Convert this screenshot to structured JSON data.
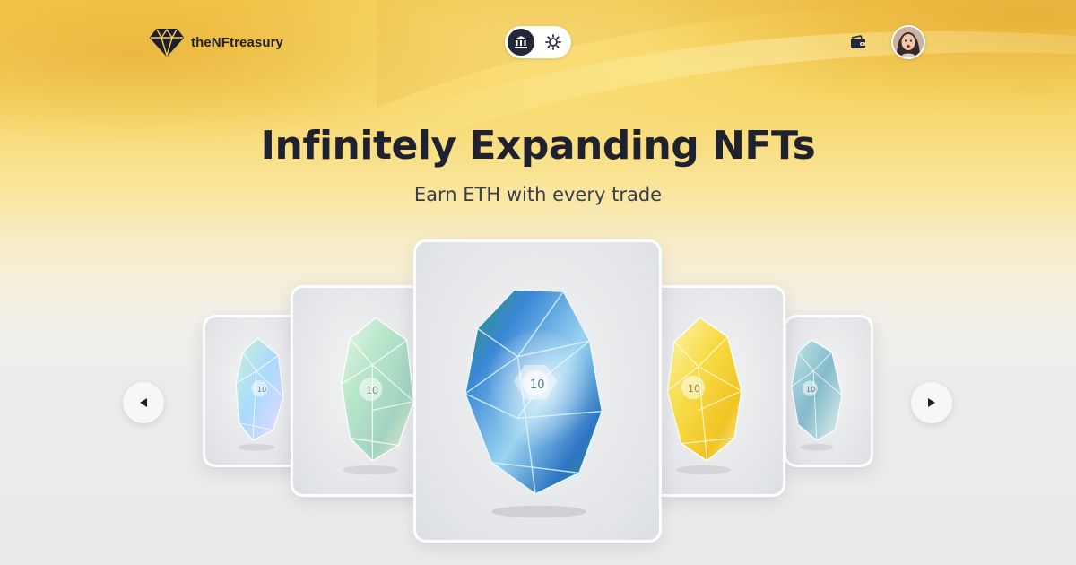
{
  "brand": {
    "name": "theNFtreasury",
    "logo_icon": "diamond-logo-icon"
  },
  "header": {
    "mode_toggle": {
      "options": [
        {
          "icon": "bank-icon",
          "active": true
        },
        {
          "icon": "sun-icon",
          "active": false
        }
      ]
    },
    "wallet_icon": "wallet-icon",
    "avatar_icon": "user-avatar"
  },
  "hero": {
    "title": "Infinitely Expanding NFTs",
    "subtitle": "Earn ETH with every trade"
  },
  "carousel": {
    "prev_icon": "arrow-left-icon",
    "next_icon": "arrow-right-icon",
    "cards": [
      {
        "label": "10",
        "tint": "iridescent-clear"
      },
      {
        "label": "10",
        "tint": "iridescent-green"
      },
      {
        "label": "10",
        "tint": "blue-green"
      },
      {
        "label": "10",
        "tint": "yellow"
      },
      {
        "label": "10",
        "tint": "teal"
      }
    ]
  },
  "colors": {
    "accent_gold": "#f3c849",
    "text_dark": "#1f222e",
    "toggle_active": "#232838"
  }
}
